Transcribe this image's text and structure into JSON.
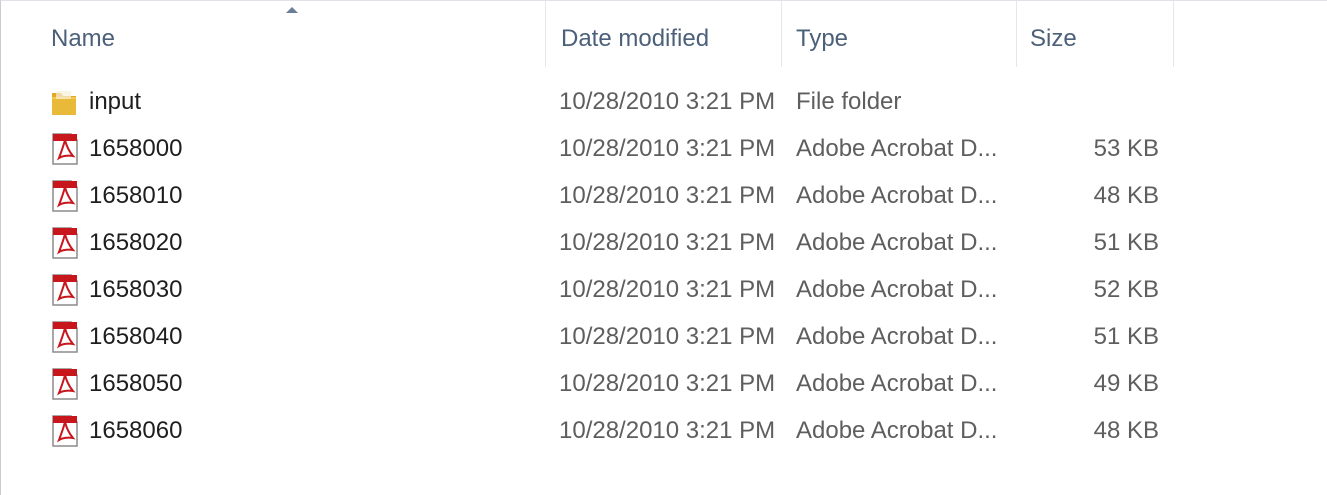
{
  "columns": {
    "name": "Name",
    "date_modified": "Date modified",
    "type": "Type",
    "size": "Size"
  },
  "sort": {
    "column": "name",
    "direction": "ascending",
    "icon": "sort-ascending-icon"
  },
  "files": [
    {
      "icon": "folder-icon",
      "name": "input",
      "date": "10/28/2010 3:21 PM",
      "type": "File folder",
      "size": ""
    },
    {
      "icon": "pdf-file-icon",
      "name": "1658000",
      "date": "10/28/2010 3:21 PM",
      "type": "Adobe Acrobat D...",
      "size": "53 KB"
    },
    {
      "icon": "pdf-file-icon",
      "name": "1658010",
      "date": "10/28/2010 3:21 PM",
      "type": "Adobe Acrobat D...",
      "size": "48 KB"
    },
    {
      "icon": "pdf-file-icon",
      "name": "1658020",
      "date": "10/28/2010 3:21 PM",
      "type": "Adobe Acrobat D...",
      "size": "51 KB"
    },
    {
      "icon": "pdf-file-icon",
      "name": "1658030",
      "date": "10/28/2010 3:21 PM",
      "type": "Adobe Acrobat D...",
      "size": "52 KB"
    },
    {
      "icon": "pdf-file-icon",
      "name": "1658040",
      "date": "10/28/2010 3:21 PM",
      "type": "Adobe Acrobat D...",
      "size": "51 KB"
    },
    {
      "icon": "pdf-file-icon",
      "name": "1658050",
      "date": "10/28/2010 3:21 PM",
      "type": "Adobe Acrobat D...",
      "size": "49 KB"
    },
    {
      "icon": "pdf-file-icon",
      "name": "1658060",
      "date": "10/28/2010 3:21 PM",
      "type": "Adobe Acrobat D...",
      "size": "48 KB"
    }
  ],
  "colors": {
    "header_text": "#4c607a",
    "folder": "#e9b93a",
    "pdf_red": "#c8161d"
  }
}
